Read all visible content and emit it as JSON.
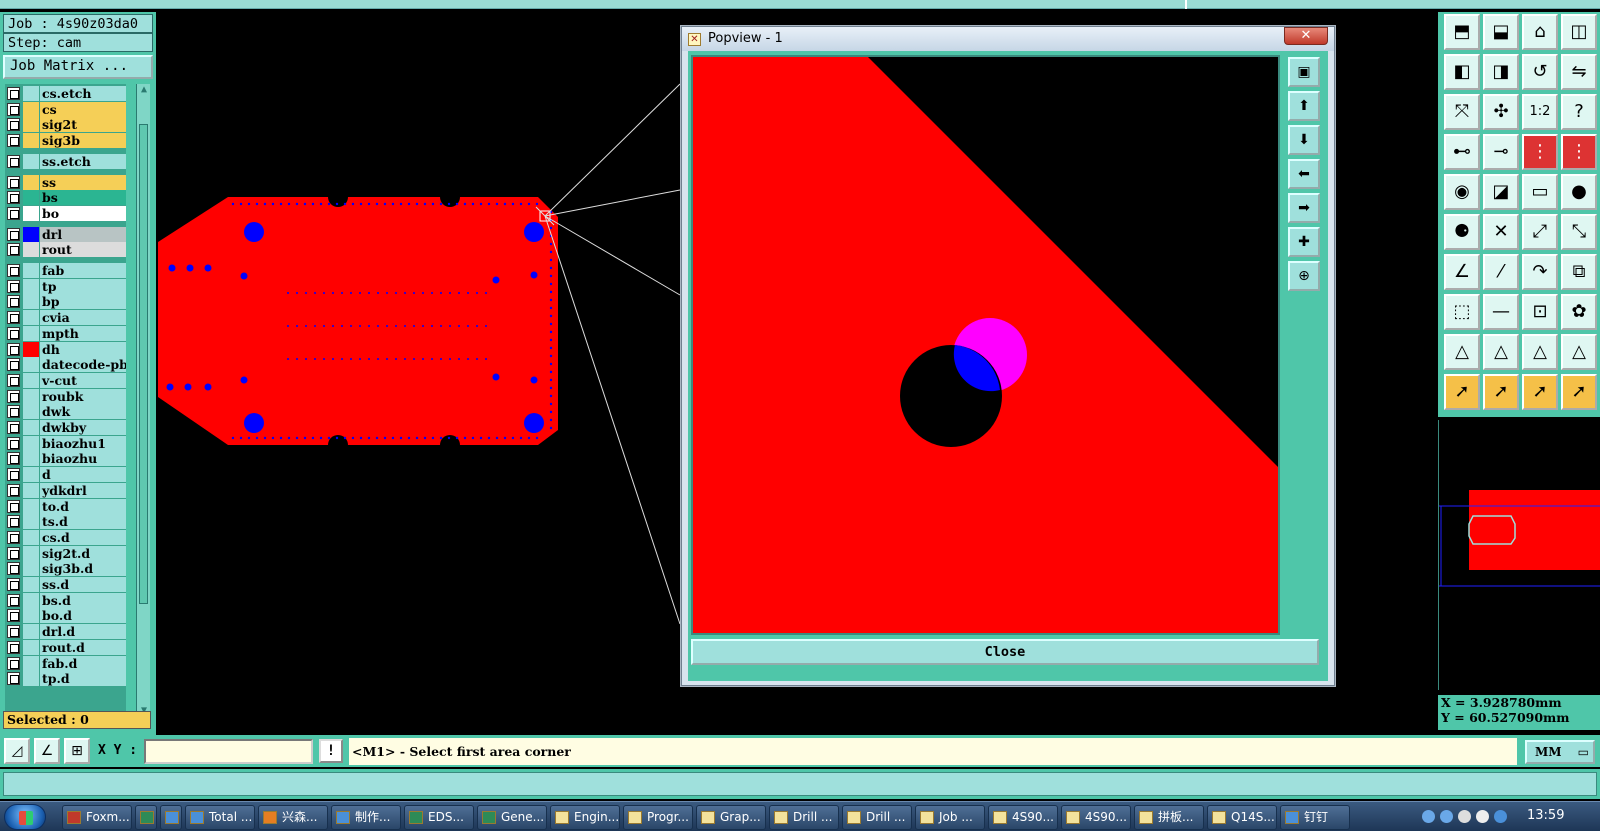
{
  "job": {
    "job_label": "Job : 4s90z03da0",
    "step_label": "Step: cam"
  },
  "job_matrix_label": "Job Matrix ...",
  "layers": [
    {
      "name": "cs.etch",
      "color": "#9fe0dc",
      "swatch": "#9fe0dc"
    },
    {
      "name": "cs",
      "color": "#f5cf57",
      "swatch": "#f5cf57"
    },
    {
      "name": "sig2t",
      "color": "#f5cf57",
      "swatch": "#f5cf57"
    },
    {
      "name": "sig3b",
      "color": "#f5cf57",
      "swatch": "#f5cf57"
    },
    {
      "name": "ss.etch",
      "color": "#9fe0dc",
      "swatch": "#9fe0dc"
    },
    {
      "name": "ss",
      "color": "#f5cf57",
      "swatch": "#f5cf57"
    },
    {
      "name": "bs",
      "color": "#2bb592",
      "swatch": "#2bb592"
    },
    {
      "name": "bo",
      "color": "#ffffff",
      "swatch": "#ffffff"
    },
    {
      "name": "drl",
      "color": "#b8c4c4",
      "swatch": "#0000ff"
    },
    {
      "name": "rout",
      "color": "#dcdcdc",
      "swatch": "#dcdcdc"
    },
    {
      "name": "fab",
      "color": "#9fe0dc",
      "swatch": "#9fe0dc"
    },
    {
      "name": "tp",
      "color": "#9fe0dc",
      "swatch": "#9fe0dc"
    },
    {
      "name": "bp",
      "color": "#9fe0dc",
      "swatch": "#9fe0dc"
    },
    {
      "name": "cvia",
      "color": "#9fe0dc",
      "swatch": "#9fe0dc"
    },
    {
      "name": "mpth",
      "color": "#9fe0dc",
      "swatch": "#9fe0dc"
    },
    {
      "name": "dh",
      "color": "#9fe0dc",
      "swatch": "#ff0000"
    },
    {
      "name": "datecode-pbe",
      "color": "#9fe0dc",
      "swatch": "#9fe0dc"
    },
    {
      "name": "v-cut",
      "color": "#9fe0dc",
      "swatch": "#9fe0dc"
    },
    {
      "name": "roubk",
      "color": "#9fe0dc",
      "swatch": "#9fe0dc"
    },
    {
      "name": "dwk",
      "color": "#9fe0dc",
      "swatch": "#9fe0dc"
    },
    {
      "name": "dwkby",
      "color": "#9fe0dc",
      "swatch": "#9fe0dc"
    },
    {
      "name": "biaozhu1",
      "color": "#9fe0dc",
      "swatch": "#9fe0dc"
    },
    {
      "name": "biaozhu",
      "color": "#9fe0dc",
      "swatch": "#9fe0dc"
    },
    {
      "name": "d",
      "color": "#9fe0dc",
      "swatch": "#9fe0dc"
    },
    {
      "name": "ydkdrl",
      "color": "#9fe0dc",
      "swatch": "#9fe0dc"
    },
    {
      "name": "to.d",
      "color": "#9fe0dc",
      "swatch": "#9fe0dc"
    },
    {
      "name": "ts.d",
      "color": "#9fe0dc",
      "swatch": "#9fe0dc"
    },
    {
      "name": "cs.d",
      "color": "#9fe0dc",
      "swatch": "#9fe0dc"
    },
    {
      "name": "sig2t.d",
      "color": "#9fe0dc",
      "swatch": "#9fe0dc"
    },
    {
      "name": "sig3b.d",
      "color": "#9fe0dc",
      "swatch": "#9fe0dc"
    },
    {
      "name": "ss.d",
      "color": "#9fe0dc",
      "swatch": "#9fe0dc"
    },
    {
      "name": "bs.d",
      "color": "#9fe0dc",
      "swatch": "#9fe0dc"
    },
    {
      "name": "bo.d",
      "color": "#9fe0dc",
      "swatch": "#9fe0dc"
    },
    {
      "name": "drl.d",
      "color": "#9fe0dc",
      "swatch": "#9fe0dc"
    },
    {
      "name": "rout.d",
      "color": "#9fe0dc",
      "swatch": "#9fe0dc"
    },
    {
      "name": "fab.d",
      "color": "#9fe0dc",
      "swatch": "#9fe0dc"
    },
    {
      "name": "tp.d",
      "color": "#9fe0dc",
      "swatch": "#9fe0dc"
    }
  ],
  "selected_label": "Selected : 0",
  "popview": {
    "title": "Popview - 1",
    "close_label": "Close"
  },
  "coords": {
    "x": "X = 3.928780mm",
    "y": "Y = 60.527090mm"
  },
  "command": {
    "xy_label": "X Y :",
    "xy_value": "",
    "prompt": "<M1> - Select first area corner",
    "unit": "MM"
  },
  "colors": {
    "board": "#ff0000",
    "hole": "#0000ff",
    "panel": "#4fc6a9",
    "magenta": "#ff00ff"
  },
  "taskbar": {
    "tasks": [
      {
        "label": "Foxm...",
        "icon": "red"
      },
      {
        "label": "",
        "icon": "green"
      },
      {
        "label": "",
        "icon": "blue"
      },
      {
        "label": "Total ...",
        "icon": "blue"
      },
      {
        "label": "兴森...",
        "icon": "orange"
      },
      {
        "label": "制作...",
        "icon": "blue"
      },
      {
        "label": "EDS...",
        "icon": "green"
      },
      {
        "label": "Gene...",
        "icon": "green"
      },
      {
        "label": "Engin...",
        "icon": ""
      },
      {
        "label": "Progr...",
        "icon": ""
      },
      {
        "label": "Grap...",
        "icon": ""
      },
      {
        "label": "Drill ...",
        "icon": ""
      },
      {
        "label": "Drill ...",
        "icon": ""
      },
      {
        "label": "Job ...",
        "icon": ""
      },
      {
        "label": "4S90...",
        "icon": ""
      },
      {
        "label": "4S90...",
        "icon": ""
      },
      {
        "label": "拼板...",
        "icon": ""
      },
      {
        "label": "Q14S...",
        "icon": ""
      },
      {
        "label": "钉钉",
        "icon": "blue"
      }
    ],
    "clock": "13:59"
  }
}
